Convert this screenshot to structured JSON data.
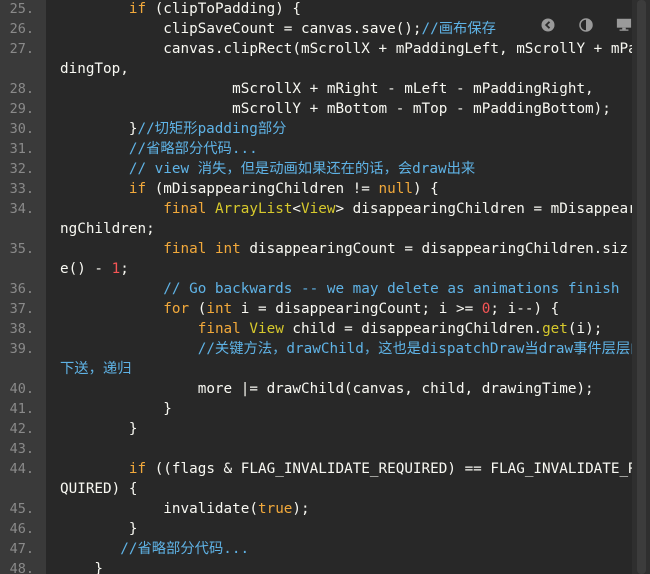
{
  "lines": [
    {
      "num": "25.",
      "top": 0,
      "segs": [
        [
          "",
          "        "
        ],
        [
          "kw",
          "if"
        ],
        [
          "",
          " (clipToPadding) {"
        ]
      ]
    },
    {
      "num": "26.",
      "segs": [
        [
          "",
          "            clipSaveCount = canvas.save();"
        ],
        [
          "cm",
          "//画布保存"
        ]
      ]
    },
    {
      "num": "27.",
      "segs": [
        [
          "",
          "            canvas.clipRect(mScrollX + mPaddingLeft, mScrollY + mPad"
        ]
      ]
    },
    {
      "num": "",
      "wrap": true,
      "segs": [
        [
          "",
          "dingTop,"
        ]
      ]
    },
    {
      "num": "28.",
      "segs": [
        [
          "",
          "                    mScrollX + mRight - mLeft - mPaddingRight,"
        ]
      ]
    },
    {
      "num": "29.",
      "segs": [
        [
          "",
          "                    mScrollY + mBottom - mTop - mPaddingBottom);"
        ]
      ]
    },
    {
      "num": "30.",
      "segs": [
        [
          "",
          "        }"
        ],
        [
          "cm",
          "//切矩形padding部分"
        ]
      ]
    },
    {
      "num": "31.",
      "segs": [
        [
          "cm",
          "        //省略部分代码..."
        ]
      ]
    },
    {
      "num": "32.",
      "segs": [
        [
          "cm",
          "        // view 消失，但是动画如果还在的话，会draw出来"
        ]
      ]
    },
    {
      "num": "33.",
      "segs": [
        [
          "",
          "        "
        ],
        [
          "kw",
          "if"
        ],
        [
          "",
          " (mDisappearingChildren != "
        ],
        [
          "kw",
          "null"
        ],
        [
          "",
          ") {"
        ]
      ]
    },
    {
      "num": "34.",
      "segs": [
        [
          "",
          "            "
        ],
        [
          "kw",
          "final"
        ],
        [
          "",
          " "
        ],
        [
          "ty",
          "ArrayList"
        ],
        [
          "",
          "<"
        ],
        [
          "ty",
          "View"
        ],
        [
          "",
          "> disappearingChildren = mDisappeari"
        ]
      ]
    },
    {
      "num": "",
      "wrap": true,
      "segs": [
        [
          "",
          "ngChildren;"
        ]
      ]
    },
    {
      "num": "35.",
      "segs": [
        [
          "",
          "            "
        ],
        [
          "kw",
          "final"
        ],
        [
          "",
          " "
        ],
        [
          "kw",
          "int"
        ],
        [
          "",
          " disappearingCount = disappearingChildren.siz"
        ]
      ]
    },
    {
      "num": "",
      "wrap": true,
      "segs": [
        [
          "",
          "e() - "
        ],
        [
          "nu",
          "1"
        ],
        [
          "",
          ";"
        ]
      ]
    },
    {
      "num": "36.",
      "segs": [
        [
          "cm",
          "            // Go backwards -- we may delete as animations finish"
        ]
      ]
    },
    {
      "num": "37.",
      "segs": [
        [
          "",
          "            "
        ],
        [
          "kw",
          "for"
        ],
        [
          "",
          " ("
        ],
        [
          "kw",
          "int"
        ],
        [
          "",
          " i = disappearingCount; i >= "
        ],
        [
          "nu",
          "0"
        ],
        [
          "",
          "; i--) {"
        ]
      ]
    },
    {
      "num": "38.",
      "segs": [
        [
          "",
          "                "
        ],
        [
          "kw",
          "final"
        ],
        [
          "",
          " "
        ],
        [
          "ty",
          "View"
        ],
        [
          "",
          " child = disappearingChildren."
        ],
        [
          "ty",
          "get"
        ],
        [
          "",
          "(i);"
        ]
      ]
    },
    {
      "num": "39.",
      "segs": [
        [
          "cm",
          "                //关键方法，drawChild，这也是dispatchDraw当draw事件层层向"
        ]
      ]
    },
    {
      "num": "",
      "wrap": true,
      "segs": [
        [
          "cm",
          "下送，递归"
        ]
      ]
    },
    {
      "num": "40.",
      "segs": [
        [
          "",
          "                more |= drawChild(canvas, child, drawingTime);"
        ]
      ]
    },
    {
      "num": "41.",
      "segs": [
        [
          "",
          "            }"
        ]
      ]
    },
    {
      "num": "42.",
      "segs": [
        [
          "",
          "        }"
        ]
      ]
    },
    {
      "num": "43.",
      "segs": [
        [
          "",
          ""
        ]
      ]
    },
    {
      "num": "44.",
      "segs": [
        [
          "",
          "        "
        ],
        [
          "kw",
          "if"
        ],
        [
          "",
          " ((flags & FLAG_INVALIDATE_REQUIRED) == FLAG_INVALIDATE_RE"
        ]
      ]
    },
    {
      "num": "",
      "wrap": true,
      "segs": [
        [
          "",
          "QUIRED) {"
        ]
      ]
    },
    {
      "num": "45.",
      "segs": [
        [
          "",
          "            invalidate("
        ],
        [
          "kw",
          "true"
        ],
        [
          "",
          ");"
        ]
      ]
    },
    {
      "num": "46.",
      "segs": [
        [
          "",
          "        }"
        ]
      ]
    },
    {
      "num": "47.",
      "segs": [
        [
          "cm",
          "       //省略部分代码..."
        ]
      ]
    },
    {
      "num": "48.",
      "segs": [
        [
          "",
          "    }"
        ]
      ]
    }
  ],
  "toolbar": {
    "icons": [
      "prev-icon",
      "contrast-icon",
      "monitor-icon"
    ]
  },
  "colors": {
    "background": "#282828",
    "gutter": "#3a3a3a",
    "keyword": "#f2a93b",
    "type": "#d7c92c",
    "comment": "#5fb3e6",
    "number": "#f65555",
    "text": "#f8f8f2"
  }
}
